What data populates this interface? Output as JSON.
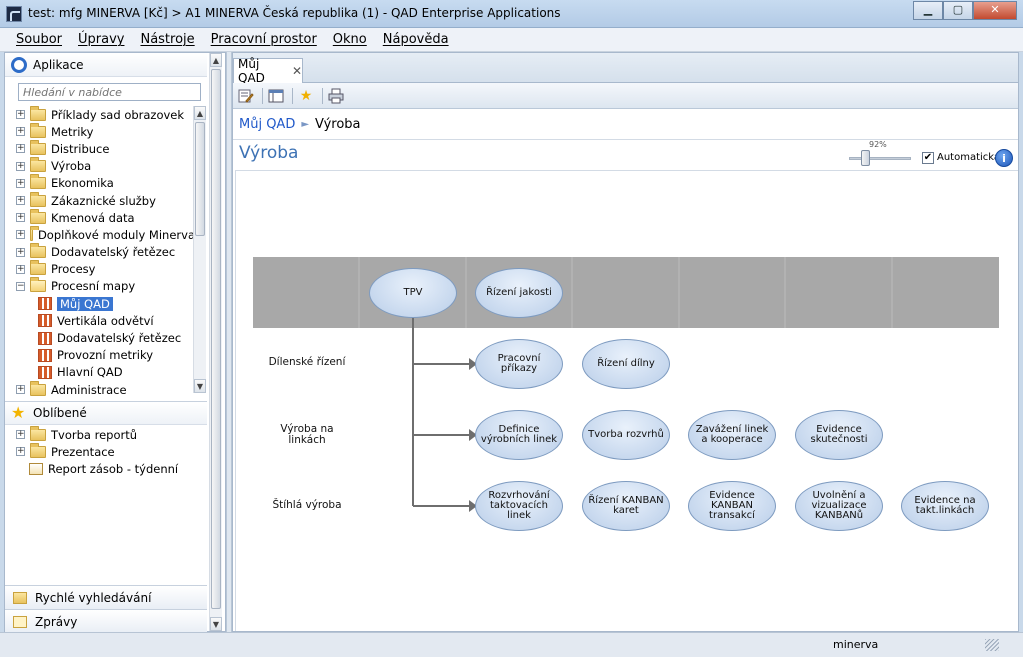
{
  "window": {
    "title": "test: mfg MINERVA [Kč] > A1 MINERVA Česká republika (1) - QAD Enterprise Applications",
    "minimize": "▁",
    "maximize": "▢",
    "close": "✕"
  },
  "menu": [
    "Soubor",
    "Úpravy",
    "Nástroje",
    "Pracovní prostor",
    "Okno",
    "Nápověda"
  ],
  "sidebar": {
    "apps_title": "Aplikace",
    "search_placeholder": "Hledání v nabídce",
    "tree": [
      {
        "label": "Příklady sad obrazovek",
        "type": "folder",
        "exp": "+"
      },
      {
        "label": "Metriky",
        "type": "folder",
        "exp": "+"
      },
      {
        "label": "Distribuce",
        "type": "folder",
        "exp": "+"
      },
      {
        "label": "Výroba",
        "type": "folder",
        "exp": "+"
      },
      {
        "label": "Ekonomika",
        "type": "folder",
        "exp": "+"
      },
      {
        "label": "Zákaznické služby",
        "type": "folder",
        "exp": "+"
      },
      {
        "label": "Kmenová data",
        "type": "folder",
        "exp": "+"
      },
      {
        "label": "Doplňkové moduly Minerva",
        "type": "folder",
        "exp": "+"
      },
      {
        "label": "Dodavatelský řetězec",
        "type": "folder",
        "exp": "+"
      },
      {
        "label": "Procesy",
        "type": "folder",
        "exp": "+"
      },
      {
        "label": "Procesní mapy",
        "type": "folder-open",
        "exp": "−"
      },
      {
        "label": "Můj QAD",
        "type": "map",
        "selected": true
      },
      {
        "label": "Vertikála odvětví",
        "type": "map"
      },
      {
        "label": "Dodavatelský řetězec",
        "type": "map"
      },
      {
        "label": "Provozní metriky",
        "type": "map"
      },
      {
        "label": "Hlavní QAD",
        "type": "map"
      },
      {
        "label": "Administrace",
        "type": "folder",
        "exp": "+"
      }
    ],
    "fav_title": "Oblíbené",
    "favorites": [
      {
        "label": "Tvorba reportů",
        "type": "folder",
        "exp": "+"
      },
      {
        "label": "Prezentace",
        "type": "folder",
        "exp": "+"
      },
      {
        "label": "Report zásob - týdenní",
        "type": "report"
      }
    ],
    "quick_search": "Rychlé vyhledávání",
    "messages": "Zprávy"
  },
  "tab": {
    "label": "Můj QAD",
    "close": "✕"
  },
  "breadcrumb": {
    "root": "Můj QAD",
    "sep": "►",
    "current": "Výroba"
  },
  "page_title": "Výroba",
  "zoom": {
    "label": "92%",
    "value": 92
  },
  "auto_label": "Automatická",
  "info": "i",
  "diagram": {
    "header_nodes": [
      "TPV",
      "Řízení jakosti"
    ],
    "rows": [
      {
        "label": "Dílenské řízení",
        "nodes": [
          "Pracovní příkazy",
          "Řízení dílny"
        ]
      },
      {
        "label": "Výroba na linkách",
        "nodes": [
          "Definice výrobních linek",
          "Tvorba rozvrhů",
          "Zavážení linek a kooperace",
          "Evidence skutečnosti"
        ]
      },
      {
        "label": "Štíhlá výroba",
        "nodes": [
          "Rozvrhování taktovacích linek",
          "Řízení KANBAN karet",
          "Evidence KANBAN transakcí",
          "Uvolnění a vizualizace KANBANů",
          "Evidence na takt.linkách"
        ]
      }
    ]
  },
  "status": {
    "user": "minerva"
  }
}
